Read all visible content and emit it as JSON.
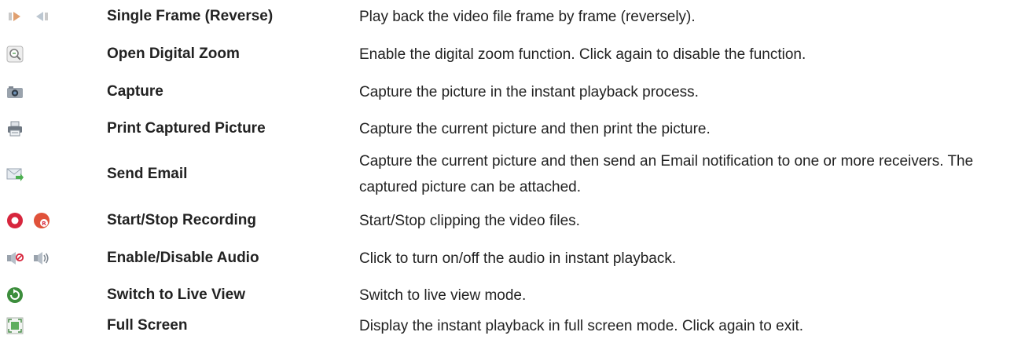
{
  "rows": [
    {
      "name": "Single Frame (Reverse)",
      "description": "Play back the video file frame by frame (reversely).",
      "icons": [
        "single-frame-forward-icon",
        "single-frame-reverse-icon"
      ]
    },
    {
      "name": "Open Digital Zoom",
      "description": "Enable the digital zoom function. Click again to disable the function.",
      "icons": [
        "digital-zoom-icon"
      ]
    },
    {
      "name": "Capture",
      "description": "Capture the picture in the instant playback process.",
      "icons": [
        "camera-capture-icon"
      ]
    },
    {
      "name": "Print Captured Picture",
      "description": "Capture the current picture and then print the picture.",
      "icons": [
        "printer-icon"
      ]
    },
    {
      "name": "Send Email",
      "description": "Capture the current picture and then send an Email notification to one or more receivers. The captured picture can be attached.",
      "icons": [
        "send-email-icon"
      ]
    },
    {
      "name": "Start/Stop Recording",
      "description": "Start/Stop clipping the video files.",
      "icons": [
        "start-recording-icon",
        "stop-recording-icon"
      ]
    },
    {
      "name": "Enable/Disable Audio",
      "description": "Click to turn on/off the audio in instant playback.",
      "icons": [
        "audio-off-icon",
        "audio-on-icon"
      ]
    },
    {
      "name": "Switch to Live View",
      "description": "Switch to live view mode.",
      "icons": [
        "live-view-icon"
      ]
    },
    {
      "name": "Full Screen",
      "description": "Display the instant playback in full screen mode. Click again to exit.",
      "icons": [
        "full-screen-icon"
      ]
    }
  ]
}
